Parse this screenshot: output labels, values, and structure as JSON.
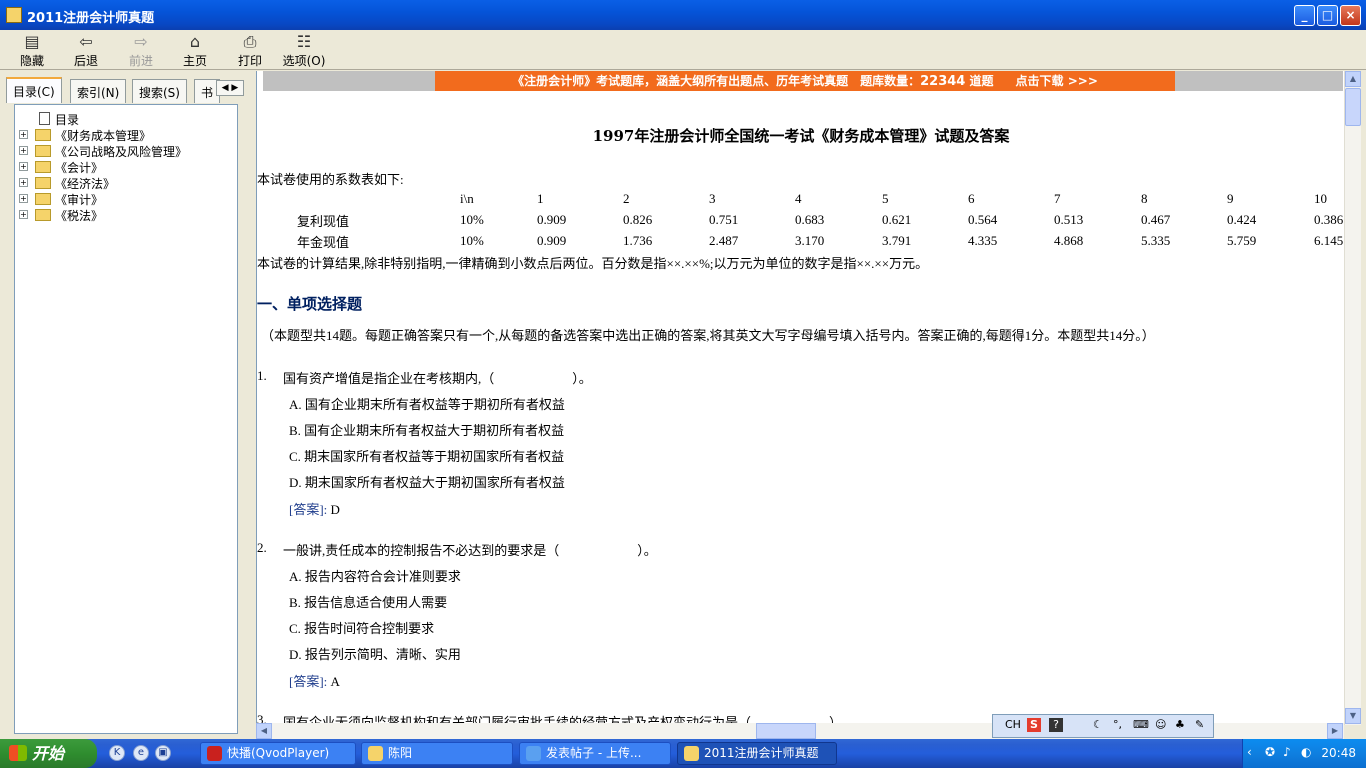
{
  "window": {
    "title": "2011注册会计师真题"
  },
  "window_buttons": {
    "minimize": "_",
    "maximize": "□",
    "close": "×"
  },
  "toolbar": {
    "hide": "隐藏",
    "back": "后退",
    "forward": "前进",
    "home": "主页",
    "print": "打印",
    "options": "选项(O)"
  },
  "nav_tabs": {
    "contents": "目录(C)",
    "index": "索引(N)",
    "search": "搜索(S)",
    "bookmarks": "书"
  },
  "tree": {
    "root": "目录",
    "items": [
      "《财务成本管理》",
      "《公司战略及风险管理》",
      "《会计》",
      "《经济法》",
      "《审计》",
      "《税法》"
    ]
  },
  "banner": {
    "part1": "《注册会计师》考试题库，涵盖大纲所有出题点、历年考试真题　题库数量：",
    "count": "22344",
    "part2": " 道题　",
    "download": "点击下载 >>>"
  },
  "doc": {
    "title": "1997年注册会计师全国统一考试《财务成本管理》试题及答案",
    "coef_intro": "本试卷使用的系数表如下:",
    "coef_table": {
      "header_label": "i\\n",
      "columns": [
        "1",
        "2",
        "3",
        "4",
        "5",
        "6",
        "7",
        "8",
        "9",
        "10"
      ],
      "rows": [
        {
          "name": "复利现值",
          "rate": "10%",
          "values": [
            "0.909",
            "0.826",
            "0.751",
            "0.683",
            "0.621",
            "0.564",
            "0.513",
            "0.467",
            "0.424",
            "0.386"
          ]
        },
        {
          "name": "年金现值",
          "rate": "10%",
          "values": [
            "0.909",
            "1.736",
            "2.487",
            "3.170",
            "3.791",
            "4.335",
            "4.868",
            "5.335",
            "5.759",
            "6.145"
          ]
        }
      ]
    },
    "precision_note": "本试卷的计算结果,除非特别指明,一律精确到小数点后两位。百分数是指××.××%;以万元为单位的数字是指××.××万元。",
    "section_title": "一、单项选择题",
    "section_note": "（本题型共14题。每题正确答案只有一个,从每题的备选答案中选出正确的答案,将其英文大写字母编号填入括号内。答案正确的,每题得1分。本题型共14分。）",
    "answer_label": "[答案]:",
    "questions": [
      {
        "num": "1.",
        "text": "国有资产增值是指企业在考核期内,（　　　　　　）。",
        "options": [
          "A.  国有企业期末所有者权益等于期初所有者权益",
          "B.  国有企业期末所有者权益大于期初所有者权益",
          "C.  期末国家所有者权益等于期初国家所有者权益",
          "D.  期末国家所有者权益大于期初国家所有者权益"
        ],
        "answer": "D"
      },
      {
        "num": "2.",
        "text": "一般讲,责任成本的控制报告不必达到的要求是（　　　　　　）。",
        "options": [
          "A.  报告内容符合会计准则要求",
          "B.  报告信息适合使用人需要",
          "C.  报告时间符合控制要求",
          "D.  报告列示简明、清晰、实用"
        ],
        "answer": "A"
      },
      {
        "num": "3.",
        "text": "国有企业无须向监督机构和有关部门履行审批手续的经营方式及产权变动行为是（　　　　　　）。"
      }
    ]
  },
  "ime": {
    "lang": "CH"
  },
  "taskbar": {
    "start": "开始",
    "tasks": [
      "快播(QvodPlayer)",
      "陈阳",
      "发表帖子 - 上传...",
      "2011注册会计师真题"
    ],
    "time": "20:48"
  },
  "colors": {
    "banner": "#f26b1d",
    "titlebar": "#0554d8",
    "taskbar": "#245edb",
    "start": "#2f8d2f"
  }
}
